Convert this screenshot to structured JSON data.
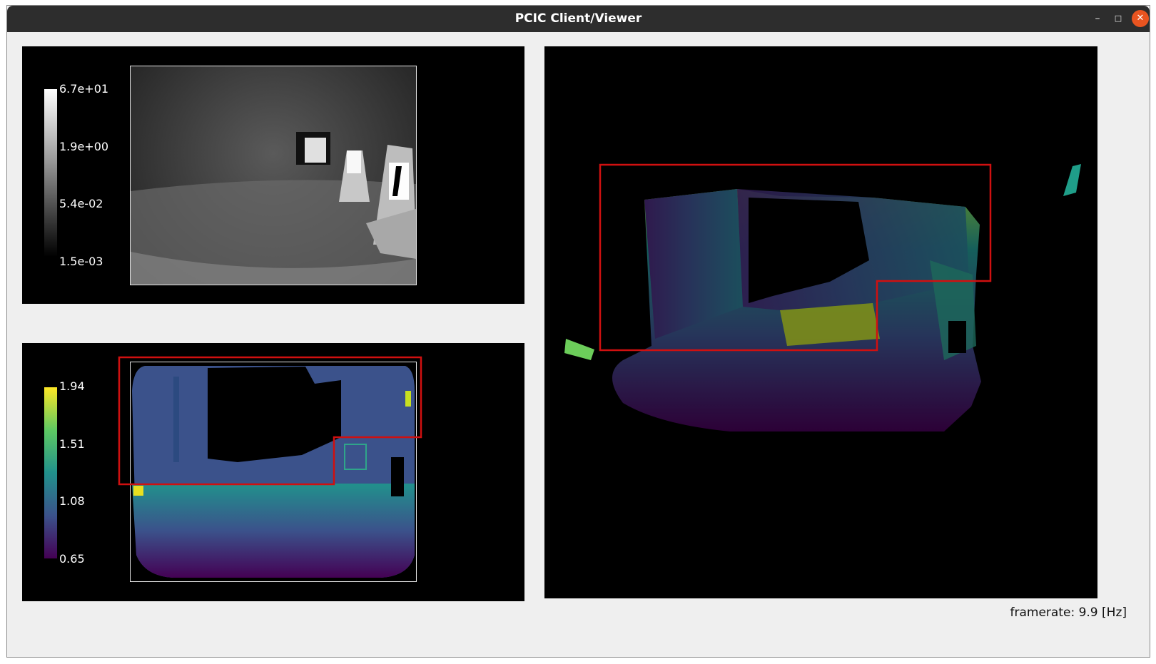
{
  "window": {
    "title": "PCIC Client/Viewer",
    "controls": {
      "minimize": "–",
      "maximize": "□",
      "close": "✕"
    }
  },
  "amplitude_view": {
    "colorbar_ticks": [
      "6.7e+01",
      "1.9e+00",
      "5.4e-02",
      "1.5e-03"
    ]
  },
  "distance_view": {
    "colorbar_ticks": [
      "1.94",
      "1.51",
      "1.08",
      "0.65"
    ]
  },
  "status": {
    "framerate": "framerate: 9.9 [Hz]"
  },
  "colors": {
    "roi": "#d01010",
    "viridis": [
      "#440154",
      "#3b528b",
      "#21918c",
      "#5ec962",
      "#fde725"
    ]
  }
}
